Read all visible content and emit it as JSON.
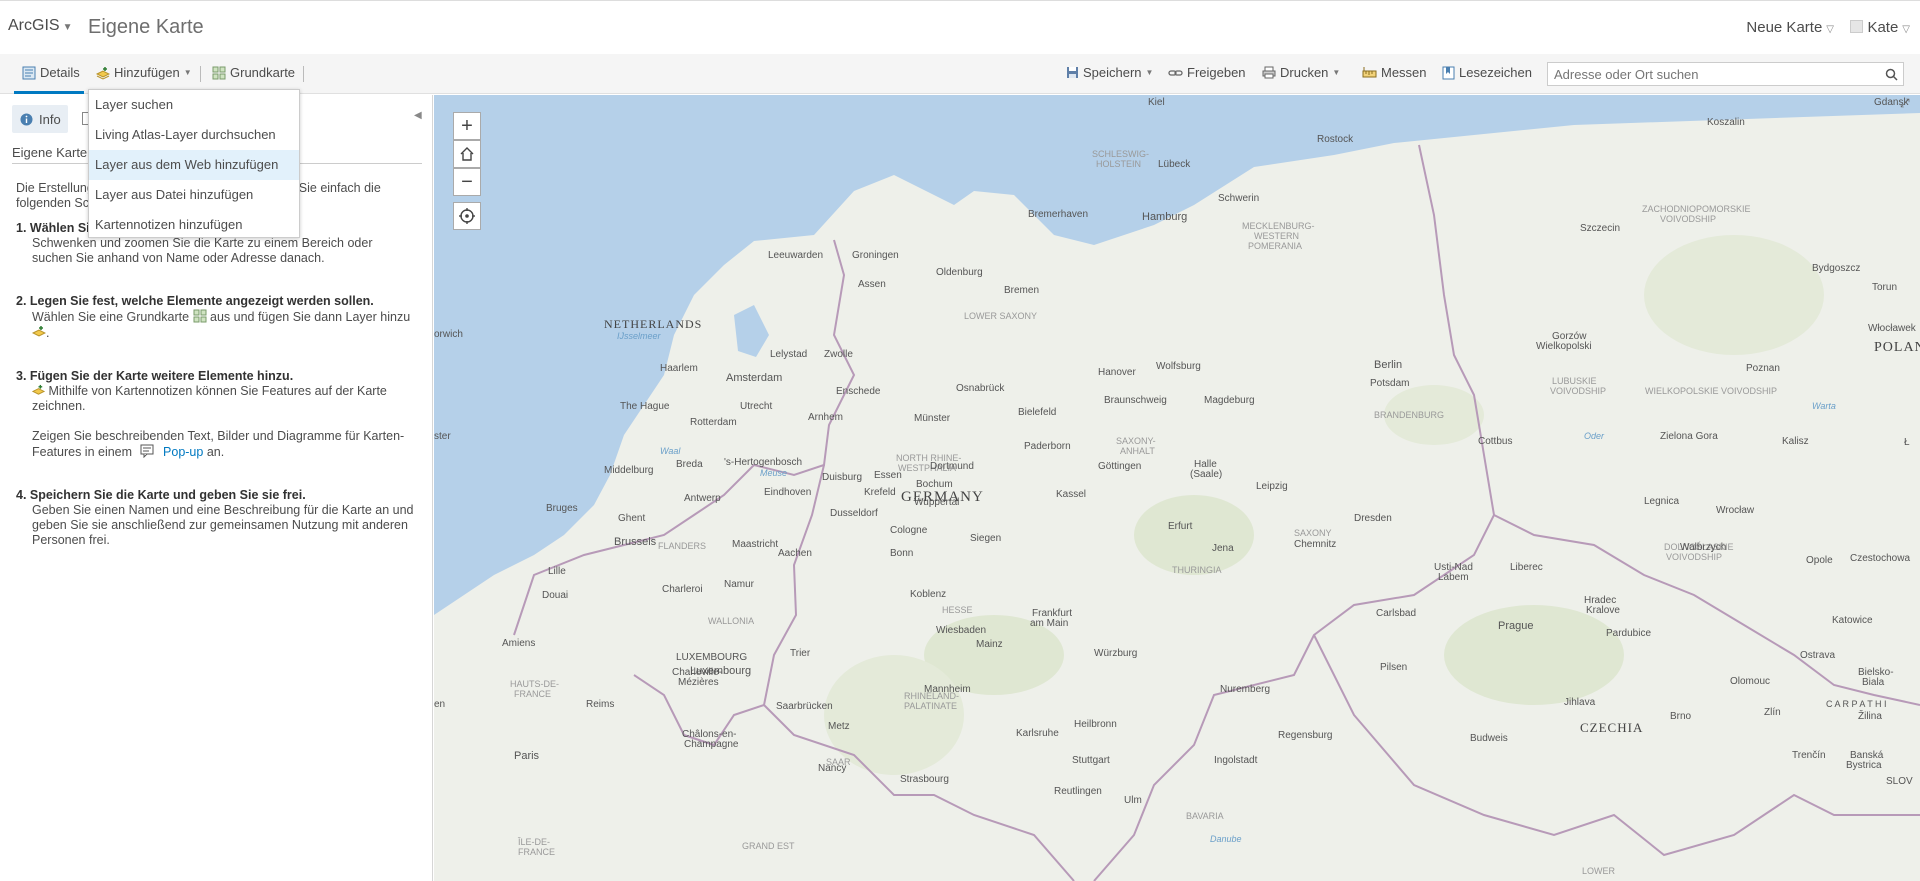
{
  "header": {
    "brand": "ArcGIS",
    "map_title": "Eigene Karte",
    "new_map": "Neue Karte",
    "user": "Kate"
  },
  "toolbar": {
    "details": "Details",
    "add": "Hinzufügen",
    "basemap": "Grundkarte",
    "save": "Speichern",
    "share": "Freigeben",
    "print": "Drucken",
    "measure": "Messen",
    "bookmarks": "Lesezeichen",
    "search_placeholder": "Adresse oder Ort suchen"
  },
  "add_menu": {
    "items": [
      {
        "label": "Layer suchen"
      },
      {
        "label": "Living Atlas-Layer durchsuchen"
      },
      {
        "label": "Layer aus dem Web hinzufügen"
      },
      {
        "label": "Layer aus Datei hinzufügen"
      },
      {
        "label": "Kartennotizen hinzufügen"
      }
    ],
    "highlighted": "Layer aus dem Web hinzufügen"
  },
  "panel": {
    "info_tab": "Info",
    "map_name": "Eigene Karte",
    "intro": "Die Erstellung einer Karte ist ganz einfach. Führen Sie einfach die folgenden Schritte aus:",
    "step1_title": "1. Wählen Sie einen Bereich aus.",
    "step1_text": "Schwenken und zoomen Sie die Karte zu einem Bereich oder suchen Sie anhand von Name oder Adresse danach.",
    "step2_title": "2. Legen Sie fest, welche Elemente angezeigt werden sollen.",
    "step2_text_a": "Wählen Sie eine Grundkarte",
    "step2_text_b": "aus und fügen Sie dann Layer hinzu",
    "step3_title": "3. Fügen Sie der Karte weitere Elemente hinzu.",
    "step3_text": "Mithilfe von Kartennotizen können Sie Features auf der Karte zeichnen.",
    "step3_text2_a": "Zeigen Sie beschreibenden Text, Bilder und Diagramme für Karten-Features in einem",
    "step3_popup": "Pop-up",
    "step3_text2_b": "an.",
    "step4_title": "4. Speichern Sie die Karte und geben Sie sie frei.",
    "step4_text": "Geben Sie einen Namen und eine Beschreibung für die Karte an und geben Sie sie anschließend zur gemeinsamen Nutzung mit anderen Personen frei."
  },
  "map": {
    "zoom_in": "+",
    "zoom_out": "−",
    "countries": {
      "netherlands": "NETHERLANDS",
      "germany": "GERMANY",
      "czechia": "CZECHIA",
      "poland": "POLAN"
    },
    "regions": {
      "lower_saxony": "LOWER SAXONY",
      "brandenburg": "BRANDENBURG",
      "hesse": "HESSE",
      "saxony": "SAXONY",
      "thuringia": "THURINGIA",
      "bavaria": "BAVARIA",
      "flanders": "FLANDERS",
      "wallonia": "WALLONIA",
      "saar": "SAAR",
      "saxony_anhalt_1": "SAXONY-",
      "saxony_anhalt_2": "ANHALT",
      "nrw_1": "NORTH RHINE-",
      "nrw_2": "WESTPHALIA",
      "rlp_1": "RHINELAND-",
      "rlp_2": "PALATINATE",
      "mv_1": "MECKLENBURG-",
      "mv_2": "WESTERN",
      "mv_3": "POMERANIA",
      "sh_1": "SCHLESWIG-",
      "sh_2": "HOLSTEIN",
      "lubuskie_1": "LUBUSKIE",
      "lubuskie_2": "VOIVODSHIP",
      "wielko": "WIELKOPOLSKIE VOIVODSHIP",
      "zachod_1": "ZACHODNIOPOMORSKIE",
      "zachod_2": "VOIVODSHIP",
      "dolnos_1": "DOLNOŚLĄSKIE",
      "dolnos_2": "VOIVODSHIP",
      "grand_est": "GRAND EST",
      "hauts_1": "HAUTS-DE-",
      "hauts_2": "FRANCE",
      "ile_1": "ÎLE-DE-",
      "ile_2": "FRANCE",
      "lower": "LOWER"
    },
    "water": {
      "ijsselmeer": "IJsselmeer",
      "meuse": "Meuse",
      "waal": "Waal",
      "warta": "Warta",
      "oder": "Oder",
      "danube": "Danube"
    },
    "cities": {
      "kiel": "Kiel",
      "rostock": "Rostock",
      "koszalin": "Koszalin",
      "gdansk": "Gdansk",
      "lubeck": "Lübeck",
      "schwerin": "Schwerin",
      "bremerhaven": "Bremerhaven",
      "hamburg": "Hamburg",
      "szczecin": "Szczecin",
      "bydgoszcz": "Bydgoszcz",
      "torun": "Torun",
      "leeuwarden": "Leeuwarden",
      "groningen": "Groningen",
      "oldenburg": "Oldenburg",
      "assen": "Assen",
      "bremen": "Bremen",
      "gorzow_1": "Gorzów",
      "gorzow_2": "Wielkopolski",
      "wloclawek": "Włocławek",
      "lelystad": "Lelystad",
      "zwolle": "Zwolle",
      "haarlem": "Haarlem",
      "amsterdam": "Amsterdam",
      "hanover": "Hanover",
      "wolfsburg": "Wolfsburg",
      "berlin": "Berlin",
      "potsdam": "Potsdam",
      "poznan": "Poznan",
      "enschede": "Enschede",
      "osnabruck": "Osnabrück",
      "braunschweig": "Braunschweig",
      "magdeburg": "Magdeburg",
      "the_hague": "The Hague",
      "utrecht": "Utrecht",
      "rotterdam": "Rotterdam",
      "arnhem": "Arnhem",
      "munster": "Münster",
      "bielefeld": "Bielefeld",
      "cottbus": "Cottbus",
      "zielona": "Zielona Gora",
      "kalisz": "Kalisz",
      "paderborn": "Paderborn",
      "middelburg": "Middelburg",
      "breda": "Breda",
      "s_hertogenbosch": "'s-Hertogenbosch",
      "duisburg": "Duisburg",
      "essen": "Essen",
      "dortmund": "Dortmund",
      "bochum": "Bochum",
      "gottingen": "Göttingen",
      "halle_1": "Halle",
      "halle_2": "(Saale)",
      "leipzig": "Leipzig",
      "bruges": "Bruges",
      "antwerp": "Antwerp",
      "eindhoven": "Eindhoven",
      "krefeld": "Krefeld",
      "wuppertal": "Wuppertal",
      "kassel": "Kassel",
      "dusseldorf": "Dusseldorf",
      "dresden": "Dresden",
      "legnica": "Legnica",
      "wroclaw": "Wrocław",
      "ghent": "Ghent",
      "erfurt": "Erfurt",
      "brussels": "Brussels",
      "maastricht": "Maastricht",
      "cologne": "Cologne",
      "siegen": "Siegen",
      "jena": "Jena",
      "chemnitz": "Chemnitz",
      "walbrzych": "Walbrzych",
      "opole": "Opole",
      "aachen": "Aachen",
      "bonn": "Bonn",
      "lille": "Lille",
      "usti_1": "Usti-Nad",
      "usti_2": "Labem",
      "liberec": "Liberec",
      "douai": "Douai",
      "charleroi": "Charleroi",
      "namur": "Namur",
      "koblenz": "Koblenz",
      "hradec_1": "Hradec",
      "hradec_2": "Kralove",
      "frankfurt_1": "Frankfurt",
      "frankfurt_2": "am Main",
      "carlsbad": "Carlsbad",
      "wiesbaden": "Wiesbaden",
      "mainz": "Mainz",
      "prague": "Prague",
      "pardubice": "Pardubice",
      "katowice": "Katowice",
      "amiens": "Amiens",
      "luxembourg_caps": "LUXEMBOURG",
      "luxembourg": "Luxembourg",
      "trier": "Trier",
      "wurzburg": "Würzburg",
      "charleville_1": "Charleville-",
      "charleville_2": "Mézières",
      "plzen": "Pilsen",
      "ostrava": "Ostrava",
      "olomouc": "Olomouc",
      "mannheim": "Mannheim",
      "nuremberg": "Nuremberg",
      "reims": "Reims",
      "saarbrucken": "Saarbrücken",
      "jihlava": "Jihlava",
      "heilbronn": "Heilbronn",
      "metz": "Metz",
      "brno": "Brno",
      "zlin": "Zlín",
      "chalons_1": "Châlons-en-",
      "chalons_2": "Champagne",
      "karlsruhe": "Karlsruhe",
      "regensburg": "Regensburg",
      "budweis": "Budweis",
      "paris": "Paris",
      "stuttgart": "Stuttgart",
      "ingolstadt": "Ingolstadt",
      "nancy": "Nancy",
      "strasbourg": "Strasbourg",
      "trencin": "Trenčín",
      "reutlingen": "Reutlingen",
      "ulm": "Ulm",
      "zilina": "Žilina",
      "bielsko_1": "Bielsko-",
      "bielsko_2": "Biala",
      "czesto": "Czestochowa",
      "norwich": "orwich",
      "ster": "ster",
      "en": "en",
      "banska_1": "Banská",
      "banska_2": "Bystrica",
      "slov": "SLOV",
      "lodz": "Ł",
      "carpathi": "C A R P A T H I"
    }
  }
}
